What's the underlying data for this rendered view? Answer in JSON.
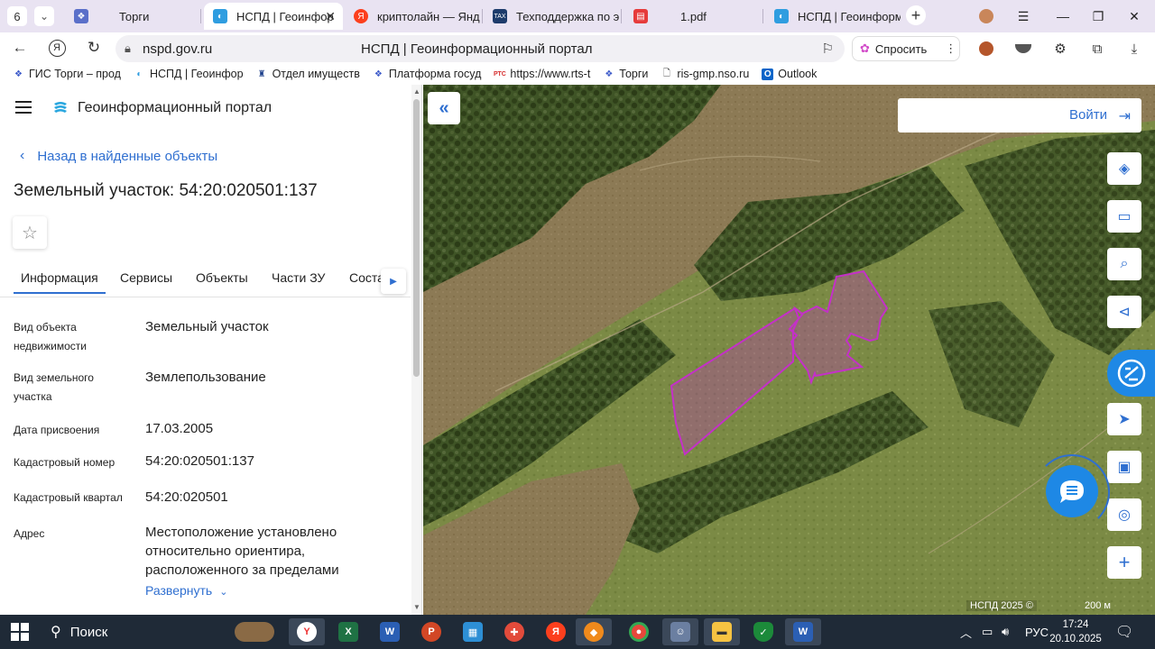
{
  "browser": {
    "tab_count": "6",
    "tabs": [
      {
        "label": "Торги",
        "icon": "torgi-icon",
        "active": false
      },
      {
        "label": "НСПД | Геоинфор",
        "icon": "nspd-icon",
        "active": true
      },
      {
        "label": "криптолайн — Янде",
        "icon": "yandex-icon",
        "active": false
      },
      {
        "label": "Техподдержка по э",
        "icon": "tax-icon",
        "active": false
      },
      {
        "label": "1.pdf",
        "icon": "pdf-icon",
        "active": false
      },
      {
        "label": "НСПД | Геоинформ",
        "icon": "nspd-icon",
        "active": false
      }
    ],
    "url": "nspd.gov.ru",
    "page_title": "НСПД | Геоинформационный портал",
    "ask_button": "Спросить",
    "bookmarks": [
      {
        "label": "ГИС Торги – прод",
        "icon": "torgi-icon"
      },
      {
        "label": "НСПД | Геоинфор",
        "icon": "nspd-icon"
      },
      {
        "label": "Отдел имуществ",
        "icon": "emblem-icon"
      },
      {
        "label": "Платформа госуд",
        "icon": "torgi-icon"
      },
      {
        "label": "https://www.rts-t",
        "icon": "rts-icon"
      },
      {
        "label": "Торги",
        "icon": "torgi-icon"
      },
      {
        "label": "ris-gmp.nso.ru",
        "icon": "page-icon"
      },
      {
        "label": "Outlook",
        "icon": "outlook-icon"
      }
    ]
  },
  "sidebar": {
    "portal_name": "Геоинформационный портал",
    "back_link": "Назад в найденные объекты",
    "object_title": "Земельный участок: 54:20:020501:137",
    "tabs": [
      "Информация",
      "Сервисы",
      "Объекты",
      "Части ЗУ",
      "Соста"
    ],
    "info": [
      {
        "label": "Вид объекта недвижимости",
        "value": "Земельный участок"
      },
      {
        "label": "Вид земельного участка",
        "value": "Землепользование"
      },
      {
        "label": "Дата присвоения",
        "value": "17.03.2005"
      },
      {
        "label": "Кадастровый номер",
        "value": "54:20:020501:137"
      },
      {
        "label": "Кадастровый квартал",
        "value": "54:20:020501"
      },
      {
        "label": "Адрес",
        "value": "Местоположение установлено относительно ориентира, расположенного за пределами"
      }
    ],
    "expand_link": "Развернуть"
  },
  "map": {
    "login": "Войти",
    "attribution": "НСПД 2025 ©",
    "scale": "200 м",
    "parcel_color": "#c430c8",
    "tools": [
      "layers-icon",
      "ruler-icon",
      "zoom-select-icon",
      "share-icon",
      "assistant-icon",
      "locate-icon",
      "print-icon",
      "geo-search-icon",
      "zoom-in-icon"
    ]
  },
  "taskbar": {
    "search_label": "Поиск",
    "language": "РУС",
    "time": "17:24",
    "date": "20.10.2025"
  }
}
